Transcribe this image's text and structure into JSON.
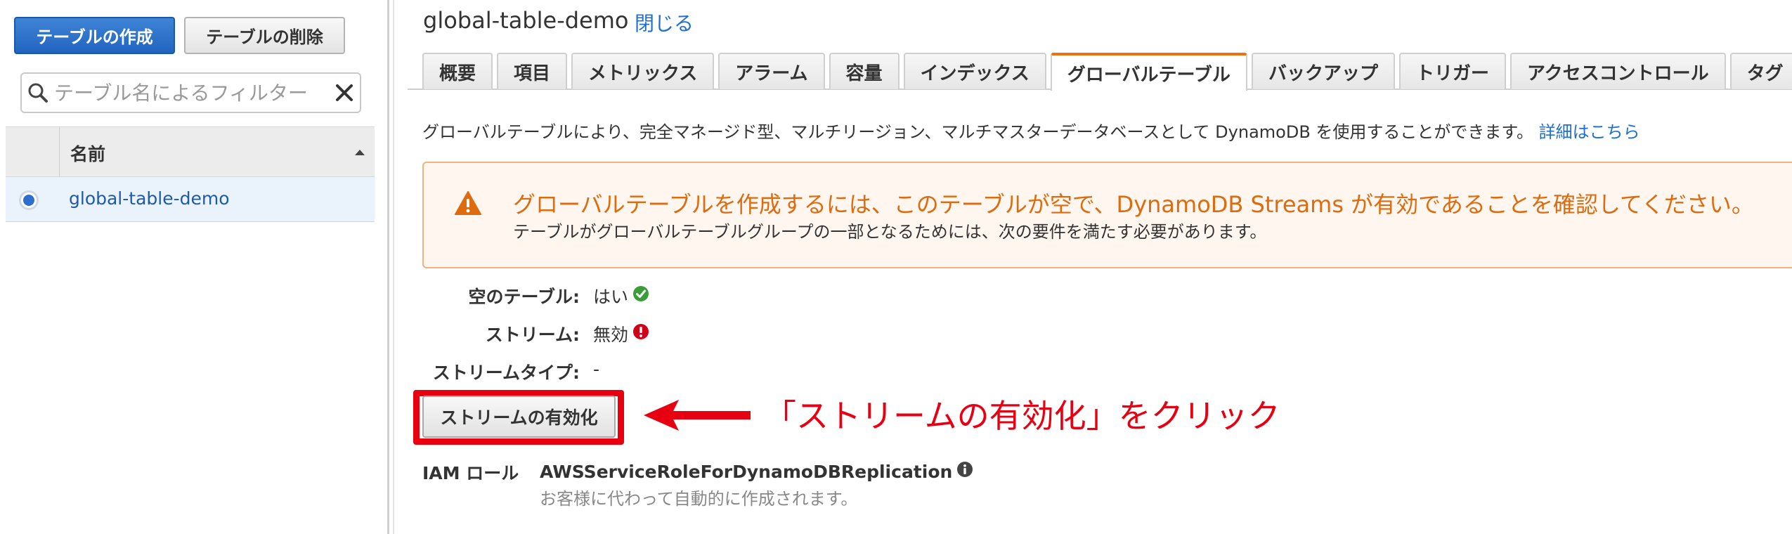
{
  "left": {
    "create_button": "テーブルの作成",
    "delete_button": "テーブルの削除",
    "filter_placeholder": "テーブル名によるフィルター",
    "column_name": "名前",
    "rows": [
      "global-table-demo"
    ]
  },
  "header": {
    "title": "global-table-demo",
    "close_link": "閉じる"
  },
  "tabs": [
    "概要",
    "項目",
    "メトリックス",
    "アラーム",
    "容量",
    "インデックス",
    "グローバルテーブル",
    "バックアップ",
    "トリガー",
    "アクセスコントロール",
    "タグ"
  ],
  "active_tab": "グローバルテーブル",
  "description": {
    "text": "グローバルテーブルにより、完全マネージド型、マルチリージョン、マルチマスターデータベースとして DynamoDB を使用することができます。",
    "more_link": "詳細はこちら"
  },
  "alert": {
    "title": "グローバルテーブルを作成するには、このテーブルが空で、DynamoDB Streams が有効であることを確認してください。",
    "subtitle": "テーブルがグローバルテーブルグループの一部となるためには、次の要件を満たす必要があります。"
  },
  "requirements": {
    "empty_label": "空のテーブル:",
    "empty_value": "はい",
    "stream_label": "ストリーム:",
    "stream_value": "無効",
    "stream_type_label": "ストリームタイプ:",
    "stream_type_value": "-"
  },
  "enable_stream_button": "ストリームの有効化",
  "annotation": "「ストリームの有効化」をクリック",
  "iam": {
    "label": "IAM ロール",
    "role": "AWSServiceRoleForDynamoDBReplication",
    "note": "お客様に代わって自動的に作成されます。"
  },
  "colors": {
    "accent_blue": "#2164c0",
    "link": "#1e6fd0",
    "warning_orange": "#dd6b10",
    "highlight_red": "#e8000e",
    "success_green": "#3a9d3a",
    "error_red": "#d0021b"
  }
}
